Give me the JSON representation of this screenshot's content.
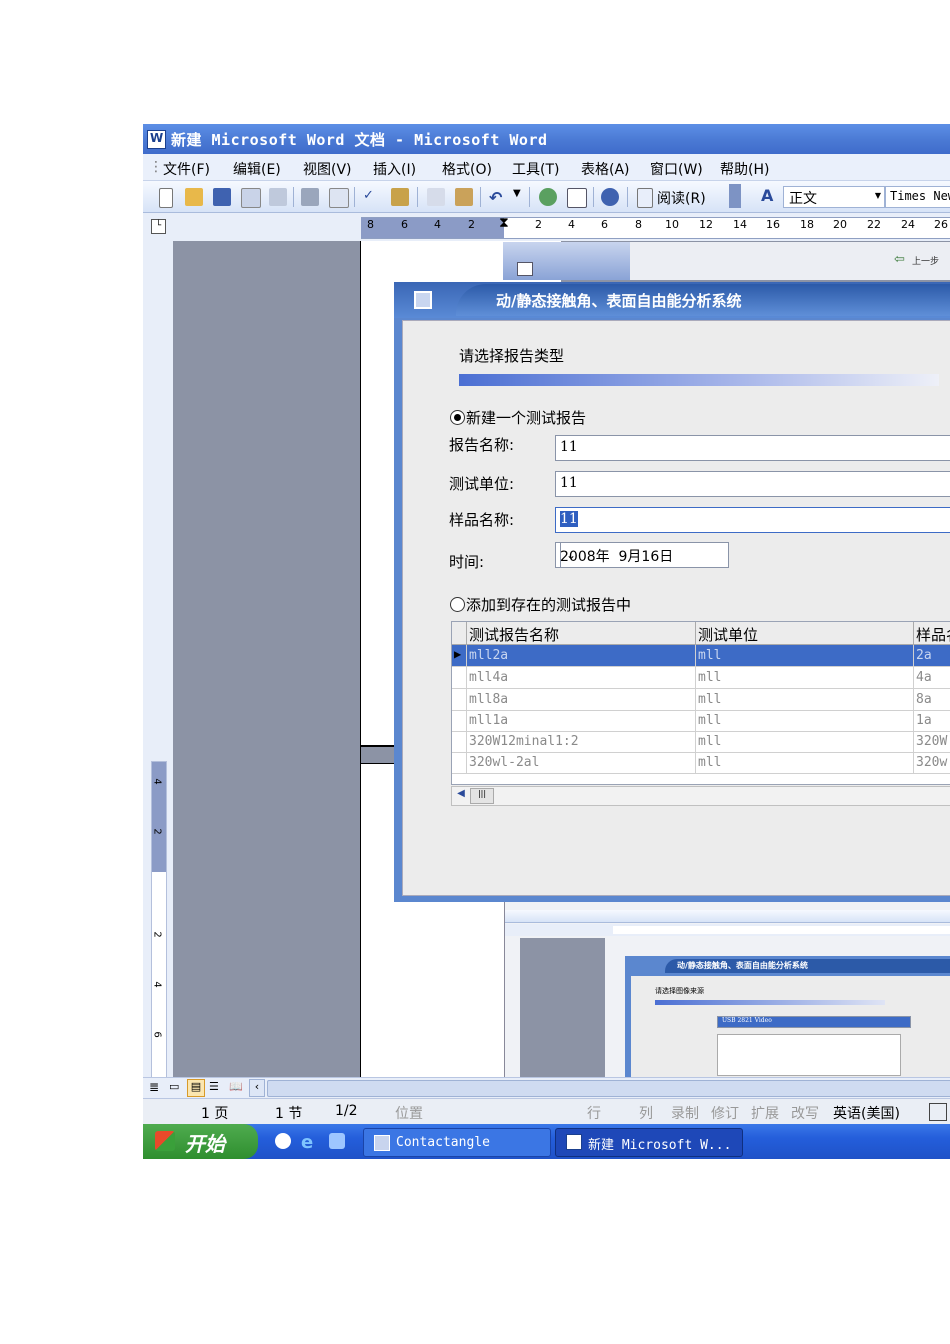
{
  "window": {
    "title": "新建 Microsoft Word 文档 - Microsoft Word"
  },
  "menu": [
    "文件(F)",
    "编辑(E)",
    "视图(V)",
    "插入(I)",
    "格式(O)",
    "工具(T)",
    "表格(A)",
    "窗口(W)",
    "帮助(H)"
  ],
  "toolbar": {
    "read_label": "阅读(R)",
    "style_value": "正文",
    "font_value": "Times New"
  },
  "ruler": {
    "numbers": [
      "8",
      "6",
      "4",
      "2",
      "2",
      "4",
      "6",
      "8",
      "10",
      "12",
      "14",
      "16",
      "18",
      "20",
      "22",
      "24",
      "26"
    ],
    "vertical": [
      "4",
      "2",
      "2",
      "4",
      "6"
    ]
  },
  "dialog": {
    "title": "动/静态接触角、表面自由能分析系统",
    "prompt": "请选择报告类型",
    "option_new": "新建一个测试报告",
    "report_name_label": "报告名称:",
    "report_name_value": "11",
    "test_unit_label": "测试单位:",
    "test_unit_value": "11",
    "sample_name_label": "样品名称:",
    "sample_name_value": "11",
    "time_label": "时间:",
    "time_value": "2008年  9月16日",
    "option_add": "添加到存在的测试报告中",
    "table": {
      "headers": [
        "测试报告名称",
        "测试单位",
        "样品名"
      ],
      "rows": [
        [
          "mll2a",
          "mll",
          "2a"
        ],
        [
          "mll4a",
          "mll",
          "4a"
        ],
        [
          "mll8a",
          "mll",
          "8a"
        ],
        [
          "mll1a",
          "mll",
          "1a"
        ],
        [
          "320W12minal1:2",
          "mll",
          "320W"
        ],
        [
          "320wl-2al",
          "mll",
          "320w"
        ]
      ]
    }
  },
  "thumbnail": {
    "dialog_title": "动/静态接触角、表面自由能分析系统",
    "prompt": "请选择图像来源",
    "select_value": "USB 2821 Video",
    "prev_label": "上一步"
  },
  "status": {
    "page": "1 页",
    "section": "1 节",
    "pages": "1/2",
    "position": "位置",
    "line": "行",
    "column": "列",
    "rec": "录制",
    "trk": "修订",
    "ext": "扩展",
    "ovr": "改写",
    "language": "英语(美国)"
  },
  "taskbar": {
    "start": "开始",
    "tasks": [
      "Contactangle",
      "新建 Microsoft W..."
    ]
  }
}
